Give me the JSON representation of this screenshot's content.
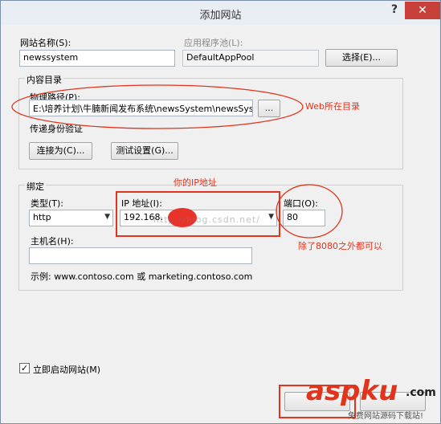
{
  "window": {
    "title": "添加网站",
    "help": "?",
    "close": "✕"
  },
  "site_name": {
    "label": "网站名称(S):",
    "value": "newssystem"
  },
  "app_pool": {
    "label": "应用程序池(L):",
    "value": "DefaultAppPool",
    "select_button": "选择(E)..."
  },
  "content": {
    "group_label": "内容目录",
    "path_label": "物理路径(P):",
    "path_value": "E:\\培养计划\\牛腩新闻发布系统\\newsSystem\\newsSyst",
    "browse_button": "...",
    "auth_label": "传递身份验证",
    "connect_button": "连接为(C)...",
    "test_button": "测试设置(G)..."
  },
  "binding": {
    "group_label": "绑定",
    "type_label": "类型(T):",
    "type_value": "http",
    "ip_label": "IP 地址(I):",
    "ip_value": "192.168.",
    "port_label": "端口(O):",
    "port_value": "80",
    "host_label": "主机名(H):",
    "host_value": "",
    "example": "示例: www.contoso.com 或 marketing.contoso.com"
  },
  "start_checkbox": {
    "label": "立即启动网站(M)",
    "checked": true
  },
  "annotations": {
    "web_dir": "Web所在目录",
    "your_ip": "你的IP地址",
    "port_hint": "除了8080之外都可以"
  },
  "watermark": "http://blog.csdn.net/",
  "brand_logo": {
    "text": "aspku",
    "domain": ".com",
    "tagline": "免费网站源码下载站!"
  },
  "colors": {
    "annotation_red": "#e0341c",
    "ip_dot": "#e8322a",
    "close_red": "#c7403a"
  }
}
